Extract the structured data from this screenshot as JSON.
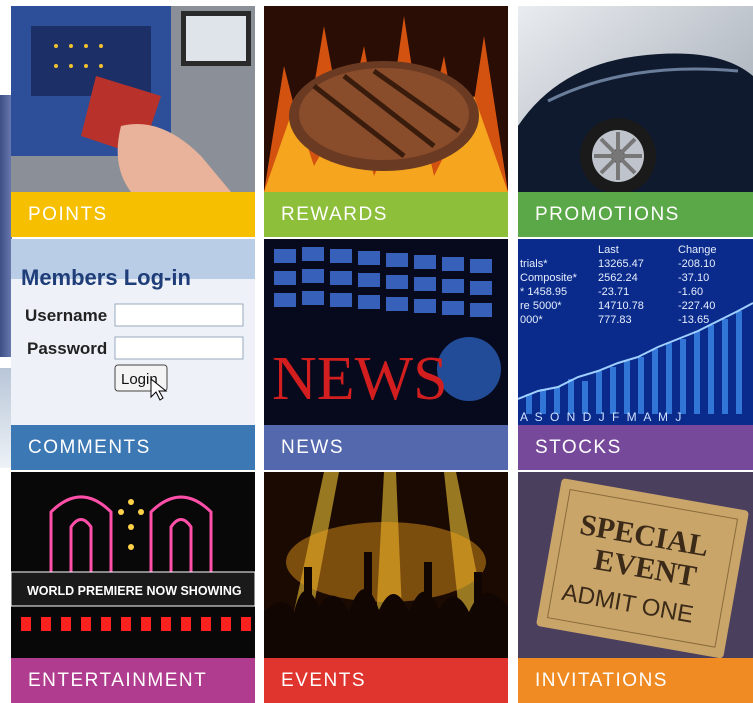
{
  "tiles": [
    {
      "id": "points",
      "label": "POINTS",
      "color": "#f6c000"
    },
    {
      "id": "rewards",
      "label": "REWARDS",
      "color": "#8dbf3a"
    },
    {
      "id": "promotions",
      "label": "PROMOTIONS",
      "color": "#5aa847"
    },
    {
      "id": "comments",
      "label": "COMMENTS",
      "color": "#3c78b4"
    },
    {
      "id": "news",
      "label": "NEWS",
      "color": "#5468ad"
    },
    {
      "id": "stocks",
      "label": "STOCKS",
      "color": "#77499b"
    },
    {
      "id": "entertainment",
      "label": "ENTERTAINMENT",
      "color": "#b03c8f"
    },
    {
      "id": "events",
      "label": "EVENTS",
      "color": "#e0342e"
    },
    {
      "id": "invitations",
      "label": "INVITATIONS",
      "color": "#ef8b22"
    }
  ],
  "login_image": {
    "heading": "Members Log-in",
    "username_label": "Username",
    "password_label": "Password",
    "button_label": "Login"
  },
  "news_image": {
    "word": "NEWS"
  },
  "stocks_image": {
    "headers": [
      "Last",
      "Change"
    ],
    "rows": [
      [
        "trials*",
        "13265.47",
        "-208.10"
      ],
      [
        "Composite*",
        "2562.24",
        "-37.10"
      ],
      [
        "* 1458.95",
        "-23.71",
        "-1.60"
      ],
      [
        "re 5000*",
        "14710.78",
        "-227.40"
      ],
      [
        "000*",
        "777.83",
        "-13.65"
      ]
    ],
    "months": "A S O N D J F M A M J"
  },
  "marquee_image": {
    "text": "WORLD PREMIERE NOW SHOWING"
  },
  "ticket_image": {
    "line1": "SPECIAL",
    "line2": "EVENT",
    "line3": "ADMIT ONE"
  }
}
